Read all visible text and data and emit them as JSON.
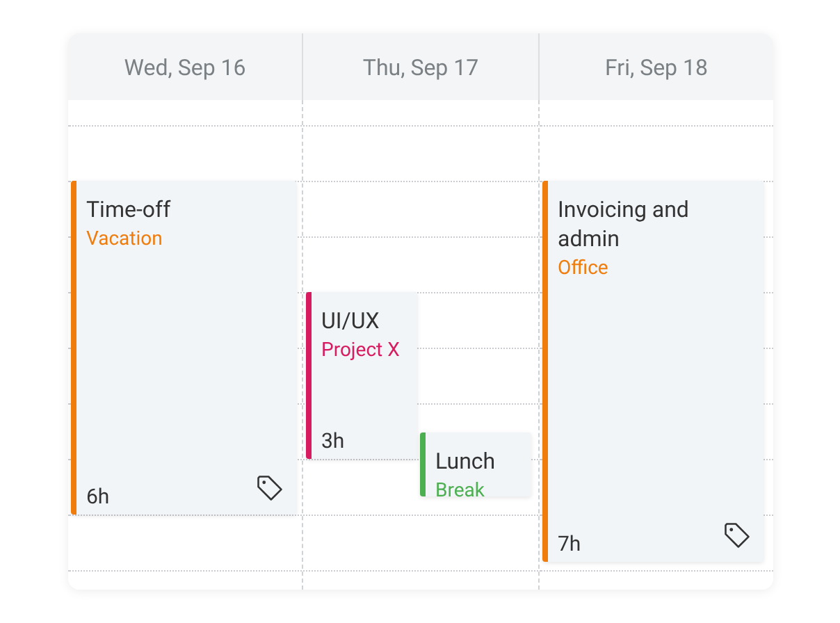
{
  "days": [
    {
      "label": "Wed, Sep 16",
      "events": [
        {
          "title": "Time-off",
          "subtitle": "Vacation",
          "color": "#f07c0c",
          "duration": "6h",
          "tagged": true
        }
      ]
    },
    {
      "label": "Thu, Sep 17",
      "events": [
        {
          "title": "UI/UX",
          "subtitle": "Project X",
          "color": "#d81b60",
          "duration": "3h",
          "tagged": false
        },
        {
          "title": "Lunch",
          "subtitle": "Break",
          "color": "#4caf50",
          "tagged": false
        }
      ]
    },
    {
      "label": "Fri, Sep 18",
      "events": [
        {
          "title": "Invoicing and admin",
          "subtitle": "Office",
          "color": "#f07c0c",
          "duration": "7h",
          "tagged": true
        }
      ]
    }
  ]
}
